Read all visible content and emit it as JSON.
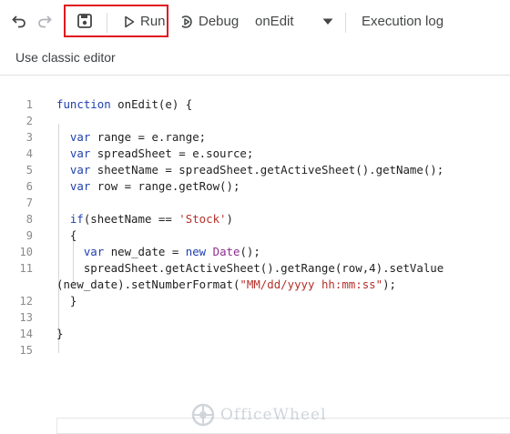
{
  "toolbar": {
    "run_label": "Run",
    "debug_label": "Debug",
    "function_select": "onEdit",
    "execution_log_label": "Execution log"
  },
  "classic_editor_label": "Use classic editor",
  "editor": {
    "line_numbers": [
      "1",
      "2",
      "3",
      "4",
      "5",
      "6",
      "7",
      "8",
      "9",
      "10",
      "11",
      "12",
      "13",
      "14",
      "15"
    ],
    "lines": [
      "function onEdit(e) {",
      "",
      "  var range = e.range;",
      "  var spreadSheet = e.source;",
      "  var sheetName = spreadSheet.getActiveSheet().getName();",
      "  var row = range.getRow();",
      "",
      "  if(sheetName == 'Stock')",
      "  {",
      "    var new_date = new Date();",
      "    spreadSheet.getActiveSheet().getRange(row,4).setValue",
      "(new_date).setNumberFormat(\"MM/dd/yyyy hh:mm:ss\");",
      "  }",
      "",
      "}",
      ""
    ]
  },
  "watermark": "OfficeWheel",
  "colors": {
    "highlight_box": "#e0161e",
    "keyword": "#1f3fae",
    "string": "#b5302a"
  }
}
